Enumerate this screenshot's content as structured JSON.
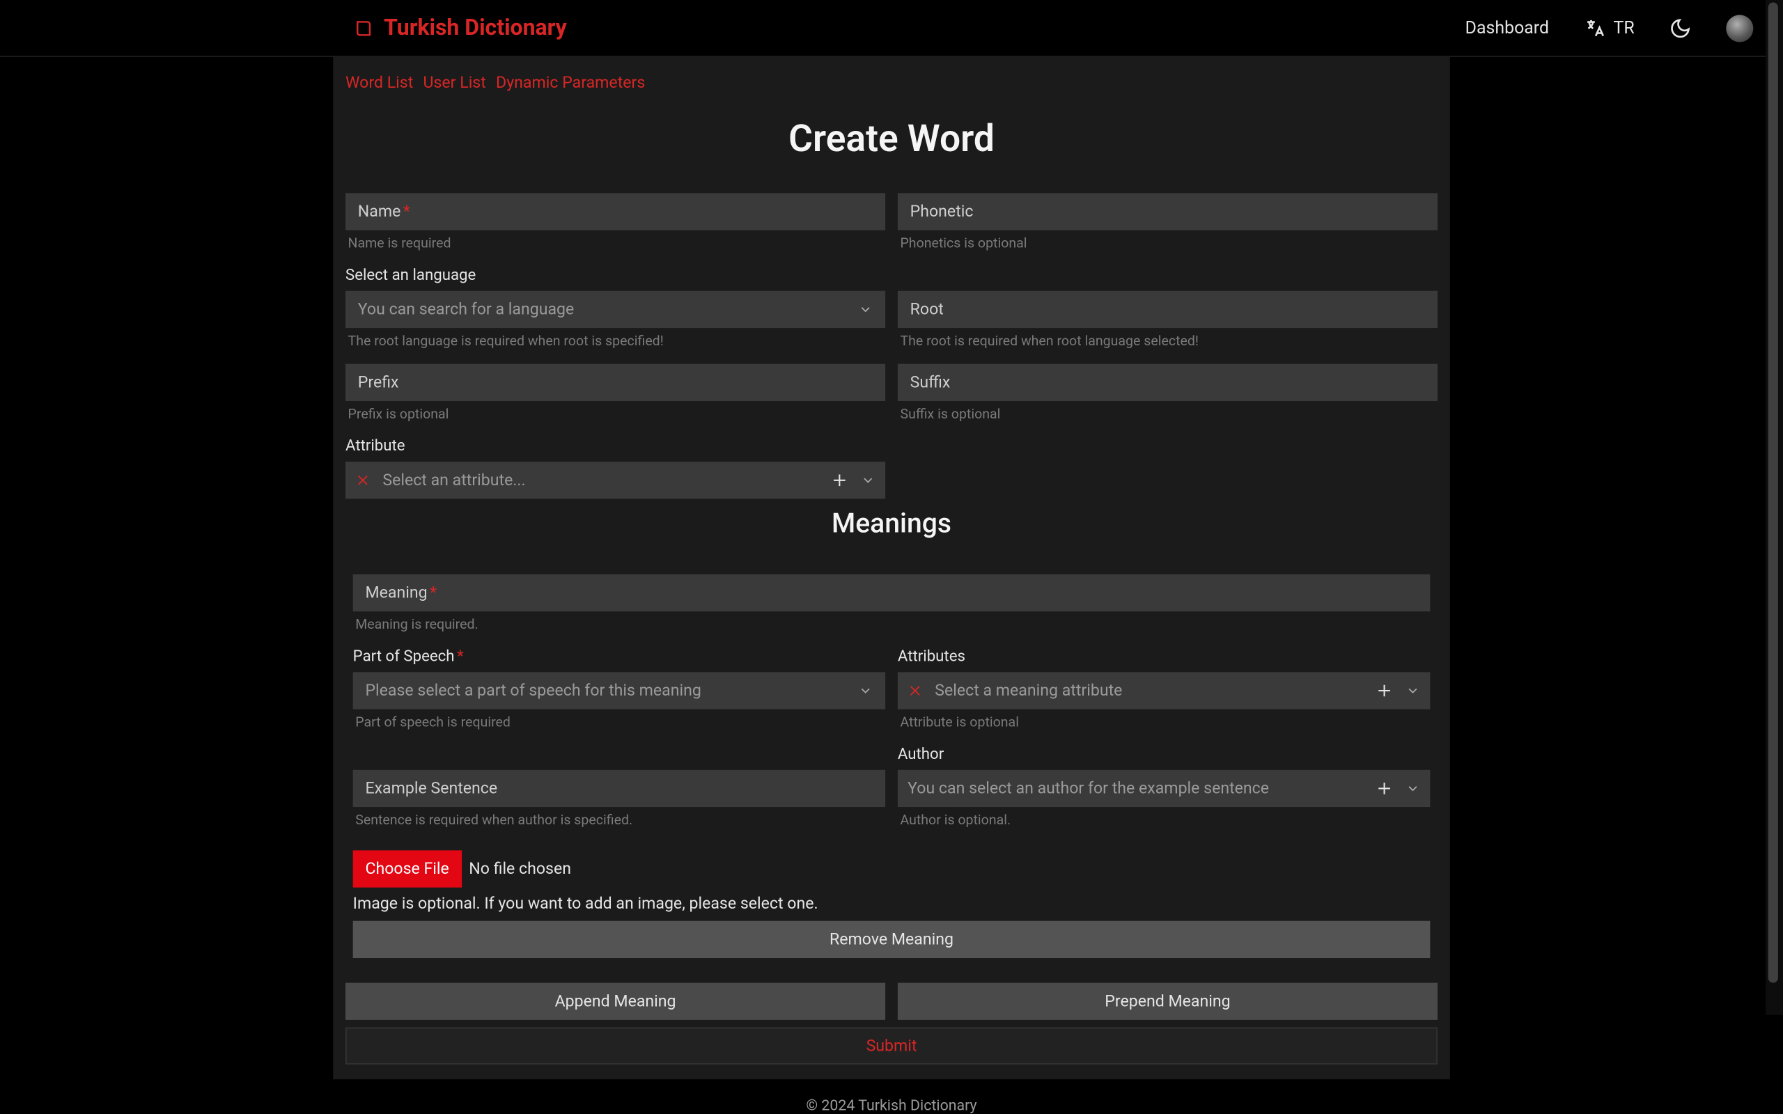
{
  "header": {
    "brand": "Turkish Dictionary",
    "dashboard": "Dashboard",
    "lang_code": "TR"
  },
  "subnav": {
    "word_list": "Word List",
    "user_list": "User List",
    "dynamic_parameters": "Dynamic Parameters"
  },
  "page": {
    "title": "Create Word",
    "meanings_title": "Meanings"
  },
  "fields": {
    "name": {
      "label": "Name",
      "hint": "Name is required"
    },
    "phonetic": {
      "label": "Phonetic",
      "hint": "Phonetics is optional"
    },
    "language": {
      "label": "Select an language",
      "placeholder": "You can search for a language",
      "hint": "The root language is required when root is specified!"
    },
    "root": {
      "label": "Root",
      "hint": "The root is required when root language selected!"
    },
    "prefix": {
      "label": "Prefix",
      "hint": "Prefix is optional"
    },
    "suffix": {
      "label": "Suffix",
      "hint": "Suffix is optional"
    },
    "attribute": {
      "label": "Attribute",
      "placeholder": "Select an attribute..."
    }
  },
  "meaning": {
    "meaning": {
      "label": "Meaning",
      "hint": "Meaning is required."
    },
    "part_of_speech": {
      "label": "Part of Speech",
      "placeholder": "Please select a part of speech for this meaning",
      "hint": "Part of speech is required"
    },
    "attributes": {
      "label": "Attributes",
      "placeholder": "Select a meaning attribute",
      "hint": "Attribute is optional"
    },
    "example": {
      "label": "Example Sentence",
      "hint": "Sentence is required when author is specified."
    },
    "author": {
      "label": "Author",
      "placeholder": "You can select an author for the example sentence",
      "hint": "Author is optional."
    },
    "choose_file": "Choose File",
    "no_file": "No file chosen",
    "image_hint": "Image is optional. If you want to add an image, please select one.",
    "remove": "Remove Meaning"
  },
  "buttons": {
    "append": "Append  Meaning",
    "prepend": "Prepend  Meaning",
    "submit": "Submit"
  },
  "footer": "© 2024 Turkish Dictionary"
}
